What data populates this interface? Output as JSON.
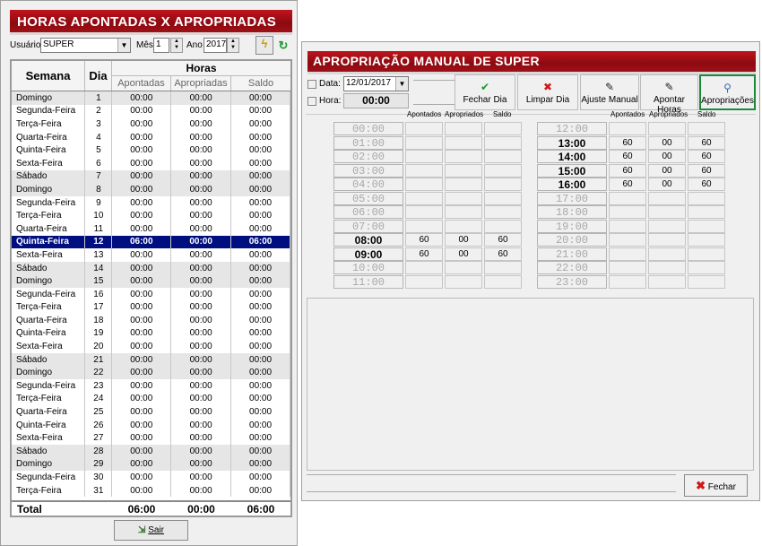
{
  "left": {
    "title": "HORAS APONTADAS X APROPRIADAS",
    "usuario_label": "Usuário",
    "usuario_value": "SUPER",
    "mes_label": "Mês",
    "mes_value": "1",
    "ano_label": "Ano",
    "ano_value": "2017",
    "headers": {
      "semana": "Semana",
      "dia": "Dia",
      "horas": "Horas",
      "apontadas": "Apontadas",
      "apropriadas": "Apropriadas",
      "saldo": "Saldo"
    },
    "rows": [
      {
        "semana": "Domingo",
        "dia": "1",
        "ap": "00:00",
        "apr": "00:00",
        "saldo": "00:00",
        "style": "gray"
      },
      {
        "semana": "Segunda-Feira",
        "dia": "2",
        "ap": "00:00",
        "apr": "00:00",
        "saldo": "00:00",
        "style": ""
      },
      {
        "semana": "Terça-Feira",
        "dia": "3",
        "ap": "00:00",
        "apr": "00:00",
        "saldo": "00:00",
        "style": ""
      },
      {
        "semana": "Quarta-Feira",
        "dia": "4",
        "ap": "00:00",
        "apr": "00:00",
        "saldo": "00:00",
        "style": ""
      },
      {
        "semana": "Quinta-Feira",
        "dia": "5",
        "ap": "00:00",
        "apr": "00:00",
        "saldo": "00:00",
        "style": ""
      },
      {
        "semana": "Sexta-Feira",
        "dia": "6",
        "ap": "00:00",
        "apr": "00:00",
        "saldo": "00:00",
        "style": ""
      },
      {
        "semana": "Sábado",
        "dia": "7",
        "ap": "00:00",
        "apr": "00:00",
        "saldo": "00:00",
        "style": "gray"
      },
      {
        "semana": "Domingo",
        "dia": "8",
        "ap": "00:00",
        "apr": "00:00",
        "saldo": "00:00",
        "style": "gray"
      },
      {
        "semana": "Segunda-Feira",
        "dia": "9",
        "ap": "00:00",
        "apr": "00:00",
        "saldo": "00:00",
        "style": ""
      },
      {
        "semana": "Terça-Feira",
        "dia": "10",
        "ap": "00:00",
        "apr": "00:00",
        "saldo": "00:00",
        "style": ""
      },
      {
        "semana": "Quarta-Feira",
        "dia": "11",
        "ap": "00:00",
        "apr": "00:00",
        "saldo": "00:00",
        "style": ""
      },
      {
        "semana": "Quinta-Feira",
        "dia": "12",
        "ap": "06:00",
        "apr": "00:00",
        "saldo": "06:00",
        "style": "sel"
      },
      {
        "semana": "Sexta-Feira",
        "dia": "13",
        "ap": "00:00",
        "apr": "00:00",
        "saldo": "00:00",
        "style": ""
      },
      {
        "semana": "Sábado",
        "dia": "14",
        "ap": "00:00",
        "apr": "00:00",
        "saldo": "00:00",
        "style": "gray"
      },
      {
        "semana": "Domingo",
        "dia": "15",
        "ap": "00:00",
        "apr": "00:00",
        "saldo": "00:00",
        "style": "gray"
      },
      {
        "semana": "Segunda-Feira",
        "dia": "16",
        "ap": "00:00",
        "apr": "00:00",
        "saldo": "00:00",
        "style": ""
      },
      {
        "semana": "Terça-Feira",
        "dia": "17",
        "ap": "00:00",
        "apr": "00:00",
        "saldo": "00:00",
        "style": ""
      },
      {
        "semana": "Quarta-Feira",
        "dia": "18",
        "ap": "00:00",
        "apr": "00:00",
        "saldo": "00:00",
        "style": ""
      },
      {
        "semana": "Quinta-Feira",
        "dia": "19",
        "ap": "00:00",
        "apr": "00:00",
        "saldo": "00:00",
        "style": ""
      },
      {
        "semana": "Sexta-Feira",
        "dia": "20",
        "ap": "00:00",
        "apr": "00:00",
        "saldo": "00:00",
        "style": ""
      },
      {
        "semana": "Sábado",
        "dia": "21",
        "ap": "00:00",
        "apr": "00:00",
        "saldo": "00:00",
        "style": "gray"
      },
      {
        "semana": "Domingo",
        "dia": "22",
        "ap": "00:00",
        "apr": "00:00",
        "saldo": "00:00",
        "style": "gray"
      },
      {
        "semana": "Segunda-Feira",
        "dia": "23",
        "ap": "00:00",
        "apr": "00:00",
        "saldo": "00:00",
        "style": ""
      },
      {
        "semana": "Terça-Feira",
        "dia": "24",
        "ap": "00:00",
        "apr": "00:00",
        "saldo": "00:00",
        "style": ""
      },
      {
        "semana": "Quarta-Feira",
        "dia": "25",
        "ap": "00:00",
        "apr": "00:00",
        "saldo": "00:00",
        "style": ""
      },
      {
        "semana": "Quinta-Feira",
        "dia": "26",
        "ap": "00:00",
        "apr": "00:00",
        "saldo": "00:00",
        "style": ""
      },
      {
        "semana": "Sexta-Feira",
        "dia": "27",
        "ap": "00:00",
        "apr": "00:00",
        "saldo": "00:00",
        "style": ""
      },
      {
        "semana": "Sábado",
        "dia": "28",
        "ap": "00:00",
        "apr": "00:00",
        "saldo": "00:00",
        "style": "gray"
      },
      {
        "semana": "Domingo",
        "dia": "29",
        "ap": "00:00",
        "apr": "00:00",
        "saldo": "00:00",
        "style": "gray"
      },
      {
        "semana": "Segunda-Feira",
        "dia": "30",
        "ap": "00:00",
        "apr": "00:00",
        "saldo": "00:00",
        "style": ""
      },
      {
        "semana": "Terça-Feira",
        "dia": "31",
        "ap": "00:00",
        "apr": "00:00",
        "saldo": "00:00",
        "style": ""
      }
    ],
    "total_label": "Total",
    "total_ap": "06:00",
    "total_apr": "00:00",
    "total_saldo": "06:00",
    "sair_label": "Sair"
  },
  "right": {
    "title": "APROPRIAÇÃO MANUAL DE SUPER",
    "data_label": "Data:",
    "data_value": "12/01/2017",
    "hora_label": "Hora:",
    "hora_value": "00:00",
    "toolbar": [
      {
        "label": "Fechar Dia",
        "icon": "check-icon"
      },
      {
        "label": "Limpar Dia",
        "icon": "clear-icon"
      },
      {
        "label": "Ajuste Manual",
        "icon": "edit-icon"
      },
      {
        "label": "Apontar Horas",
        "icon": "edit-icon"
      },
      {
        "label": "Apropriações",
        "icon": "search-icon"
      }
    ],
    "col_headers": {
      "apontados": "Apontados",
      "apropriados": "Apropriados",
      "saldo": "Saldo"
    },
    "hours_am": [
      {
        "h": "00:00",
        "on": false,
        "a": "",
        "b": "",
        "c": ""
      },
      {
        "h": "01:00",
        "on": false,
        "a": "",
        "b": "",
        "c": ""
      },
      {
        "h": "02:00",
        "on": false,
        "a": "",
        "b": "",
        "c": ""
      },
      {
        "h": "03:00",
        "on": false,
        "a": "",
        "b": "",
        "c": ""
      },
      {
        "h": "04:00",
        "on": false,
        "a": "",
        "b": "",
        "c": ""
      },
      {
        "h": "05:00",
        "on": false,
        "a": "",
        "b": "",
        "c": ""
      },
      {
        "h": "06:00",
        "on": false,
        "a": "",
        "b": "",
        "c": ""
      },
      {
        "h": "07:00",
        "on": false,
        "a": "",
        "b": "",
        "c": ""
      },
      {
        "h": "08:00",
        "on": true,
        "a": "60",
        "b": "00",
        "c": "60"
      },
      {
        "h": "09:00",
        "on": true,
        "a": "60",
        "b": "00",
        "c": "60"
      },
      {
        "h": "10:00",
        "on": false,
        "a": "",
        "b": "",
        "c": ""
      },
      {
        "h": "11:00",
        "on": false,
        "a": "",
        "b": "",
        "c": ""
      }
    ],
    "hours_pm": [
      {
        "h": "12:00",
        "on": false,
        "a": "",
        "b": "",
        "c": ""
      },
      {
        "h": "13:00",
        "on": true,
        "a": "60",
        "b": "00",
        "c": "60"
      },
      {
        "h": "14:00",
        "on": true,
        "a": "60",
        "b": "00",
        "c": "60"
      },
      {
        "h": "15:00",
        "on": true,
        "a": "60",
        "b": "00",
        "c": "60"
      },
      {
        "h": "16:00",
        "on": true,
        "a": "60",
        "b": "00",
        "c": "60"
      },
      {
        "h": "17:00",
        "on": false,
        "a": "",
        "b": "",
        "c": ""
      },
      {
        "h": "18:00",
        "on": false,
        "a": "",
        "b": "",
        "c": ""
      },
      {
        "h": "19:00",
        "on": false,
        "a": "",
        "b": "",
        "c": ""
      },
      {
        "h": "20:00",
        "on": false,
        "a": "",
        "b": "",
        "c": ""
      },
      {
        "h": "21:00",
        "on": false,
        "a": "",
        "b": "",
        "c": ""
      },
      {
        "h": "22:00",
        "on": false,
        "a": "",
        "b": "",
        "c": ""
      },
      {
        "h": "23:00",
        "on": false,
        "a": "",
        "b": "",
        "c": ""
      }
    ],
    "fechar_label": "Fechar"
  },
  "colors": {
    "title_red": "#a01018",
    "selected_row": "#000f80",
    "highlight_border": "#1a8a3a"
  }
}
